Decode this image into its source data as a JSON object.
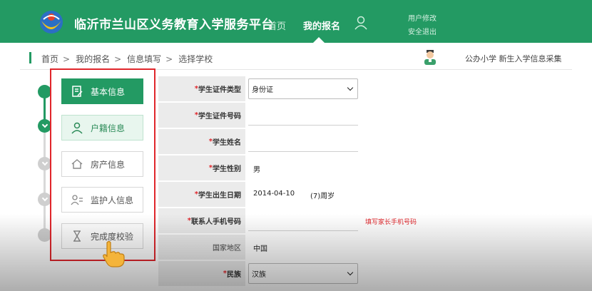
{
  "header": {
    "site_title": "临沂市兰山区义务教育入学服务平台",
    "nav_home": "首页",
    "nav_my_application": "我的报名",
    "user_modify": "用户修改",
    "logout": "安全退出",
    "bg_color": "#239a63"
  },
  "breadcrumb": {
    "items": [
      "首页",
      "我的报名",
      "信息填写",
      "选择学校"
    ],
    "separator": ">",
    "right_text": "公办小学 新生入学信息采集"
  },
  "steps": [
    {
      "label": "基本信息",
      "icon": "form-icon",
      "state": "active"
    },
    {
      "label": "户籍信息",
      "icon": "person-icon",
      "state": "done"
    },
    {
      "label": "房产信息",
      "icon": "house-icon",
      "state": "pending"
    },
    {
      "label": "监护人信息",
      "icon": "guardian-icon",
      "state": "pending"
    },
    {
      "label": "完成度校验",
      "icon": "hourglass-icon",
      "state": "pending"
    }
  ],
  "form": {
    "id_type_label": "学生证件类型",
    "id_type_value": "身份证",
    "id_number_label": "学生证件号码",
    "name_label": "学生姓名",
    "gender_label": "学生性别",
    "gender_value": "男",
    "birthdate_label": "学生出生日期",
    "birthdate_value": "2014-04-10",
    "age_value": "(7)周岁",
    "phone_label": "联系人手机号码",
    "phone_hint": "填写家长手机号码",
    "region_label": "国家地区",
    "region_value": "中国",
    "ethnicity_label": "民族",
    "ethnicity_value": "汉族",
    "required_mark": "*"
  },
  "colors": {
    "accent": "#239a63",
    "highlight": "#e0262b"
  }
}
